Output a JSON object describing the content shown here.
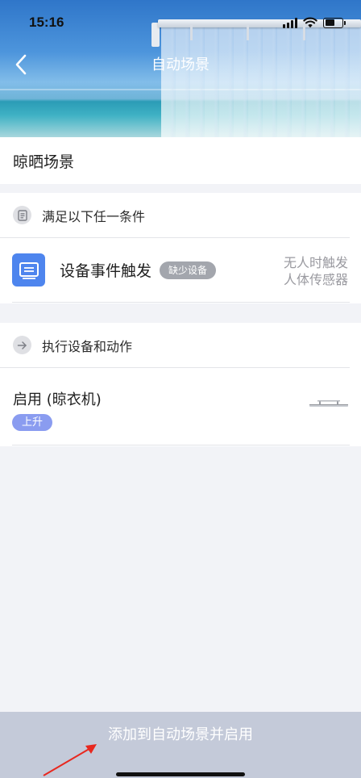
{
  "status_bar": {
    "time": "15:16",
    "battery_level": 0.55
  },
  "header": {
    "title": "自动场景",
    "back_icon": "chevron-left-icon"
  },
  "scene": {
    "name": "晾晒场景"
  },
  "conditions": {
    "heading": "满足以下任一条件",
    "heading_icon": "document-icon",
    "items": [
      {
        "title": "设备事件触发",
        "badge": "缺少设备",
        "detail_line1": "无人时触发",
        "detail_line2": "人体传感器",
        "icon": "device-screen-icon"
      }
    ]
  },
  "actions": {
    "heading": "执行设备和动作",
    "heading_icon": "arrow-right-icon",
    "items": [
      {
        "title": "启用 (晾衣机)",
        "tag": "上升",
        "icon": "clothes-hanger-device-icon"
      }
    ]
  },
  "footer": {
    "button_label": "添加到自动场景并启用"
  },
  "colors": {
    "accent_blue": "#4e85ee",
    "tag_purple": "#8a9cf0",
    "badge_gray": "#a3a6ad",
    "button_bg": "#c4cad9",
    "annotation_red": "#e8281f"
  }
}
